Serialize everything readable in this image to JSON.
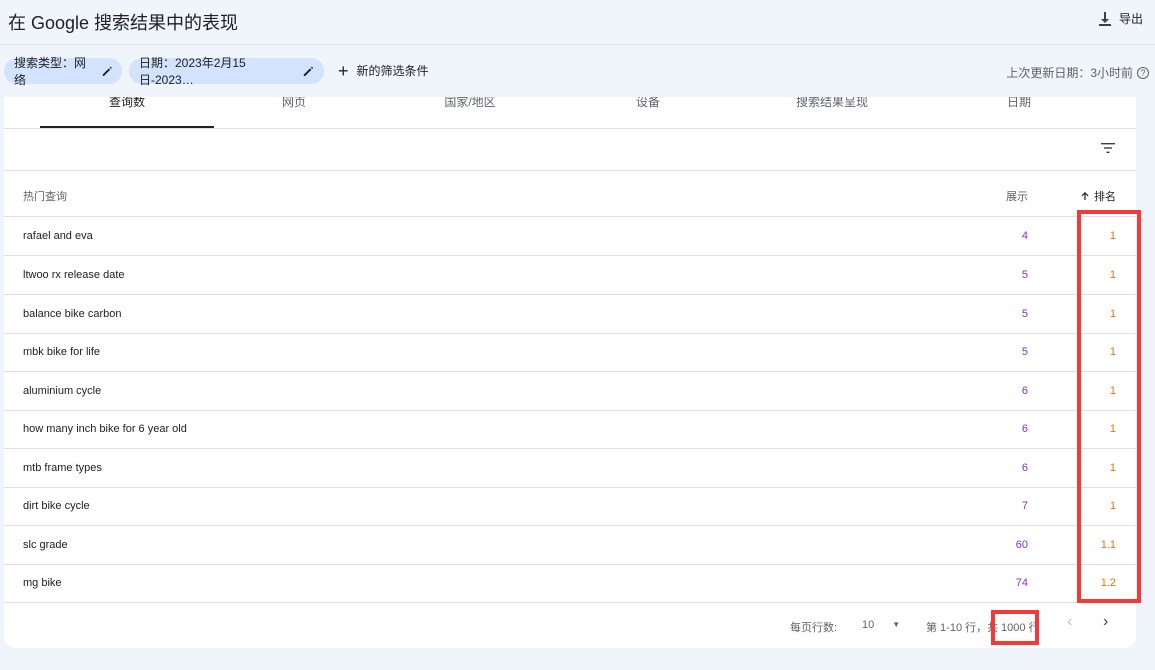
{
  "header": {
    "title": "在 Google 搜索结果中的表现",
    "export_label": "导出"
  },
  "filters": {
    "type_chip": "搜索类型：网络",
    "date_chip": "日期：2023年2月15日-2023…",
    "new_filter_label": "新的筛选条件",
    "updated_text": "上次更新日期：3小时前"
  },
  "tabs": [
    {
      "label": "查询数"
    },
    {
      "label": "网页"
    },
    {
      "label": "国家/地区"
    },
    {
      "label": "设备"
    },
    {
      "label": "搜索结果呈现"
    },
    {
      "label": "日期"
    }
  ],
  "table": {
    "columns": {
      "query": "热门查询",
      "impressions": "展示",
      "position": "排名"
    },
    "rows": [
      {
        "query": "rafael and eva",
        "impressions": "4",
        "position": "1"
      },
      {
        "query": "ltwoo rx release date",
        "impressions": "5",
        "position": "1"
      },
      {
        "query": "balance bike carbon",
        "impressions": "5",
        "position": "1"
      },
      {
        "query": "mbk bike for life",
        "impressions": "5",
        "position": "1"
      },
      {
        "query": "aluminium cycle",
        "impressions": "6",
        "position": "1"
      },
      {
        "query": "how many inch bike for 6 year old",
        "impressions": "6",
        "position": "1"
      },
      {
        "query": "mtb frame types",
        "impressions": "6",
        "position": "1"
      },
      {
        "query": "dirt bike cycle",
        "impressions": "7",
        "position": "1"
      },
      {
        "query": "slc grade",
        "impressions": "60",
        "position": "1.1"
      },
      {
        "query": "mg bike",
        "impressions": "74",
        "position": "1.2"
      }
    ]
  },
  "pagination": {
    "rows_per_page_label": "每页行数:",
    "rows_per_page_value": "10",
    "range_text": "第 1-10 行，共",
    "total_text": "1000 行"
  },
  "colors": {
    "impressions": "#8430ce",
    "position": "#e8710a",
    "highlight": "#f23a3a",
    "chip": "#d3e3fd"
  }
}
